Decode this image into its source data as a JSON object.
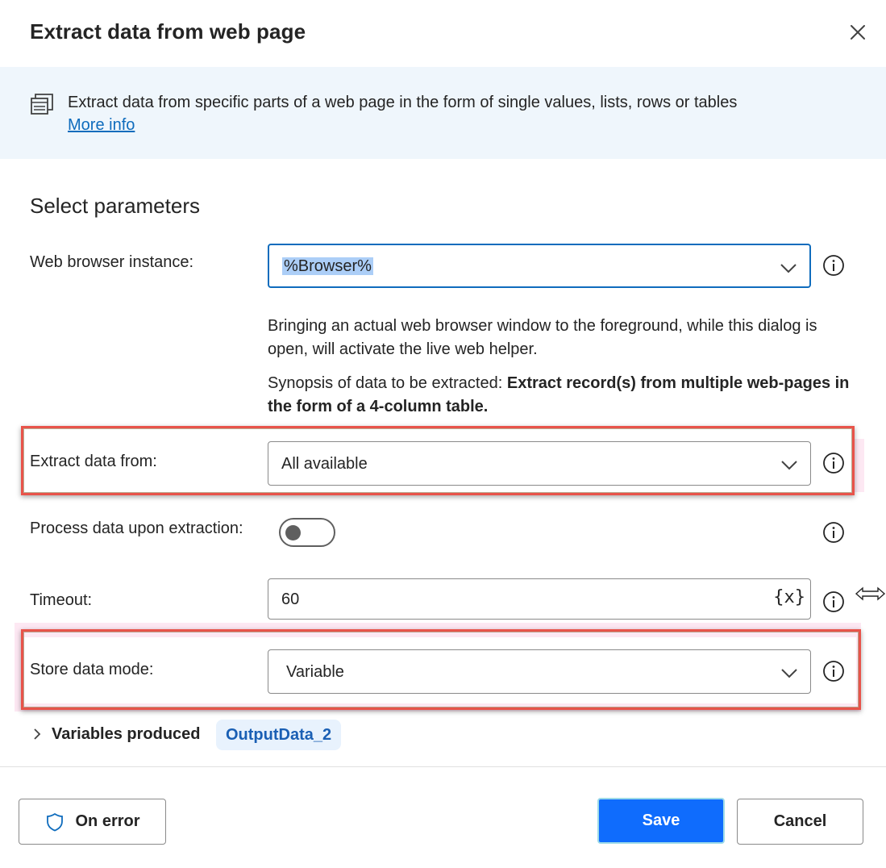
{
  "dialog": {
    "title": "Extract data from web page"
  },
  "banner": {
    "description": "Extract data from specific parts of a web page in the form of single values, lists, rows or tables",
    "link": "More info"
  },
  "section": {
    "title": "Select parameters"
  },
  "fields": {
    "browser": {
      "label": "Web browser instance:",
      "value": "%Browser%"
    },
    "help1": "Bringing an actual web browser window to the foreground, while this dialog is open, will activate the live web helper.",
    "synopsis": {
      "prefix": "Synopsis of data to be extracted: ",
      "bold": "Extract record(s) from multiple web-pages in the form of a 4-column table."
    },
    "extract_from": {
      "label": "Extract data from:",
      "value": "All available"
    },
    "process": {
      "label": "Process data upon extraction:",
      "enabled": false
    },
    "timeout": {
      "label": "Timeout:",
      "value": "60",
      "var_button": "{x}"
    },
    "store_mode": {
      "label": "Store data mode:",
      "value": "Variable"
    }
  },
  "variables": {
    "label": "Variables produced",
    "items": [
      "OutputData_2"
    ]
  },
  "footer": {
    "on_error": "On error",
    "save": "Save",
    "cancel": "Cancel"
  },
  "colors": {
    "accent": "#0f6cbd",
    "save_bg": "#0f6cfd",
    "highlight": "#e8534a",
    "banner_bg": "#eff6fc"
  },
  "icons": {
    "close": "close-icon",
    "banner": "copy-icon",
    "chevron": "chevron-down-icon",
    "info": "info-icon",
    "shield": "shield-icon"
  }
}
